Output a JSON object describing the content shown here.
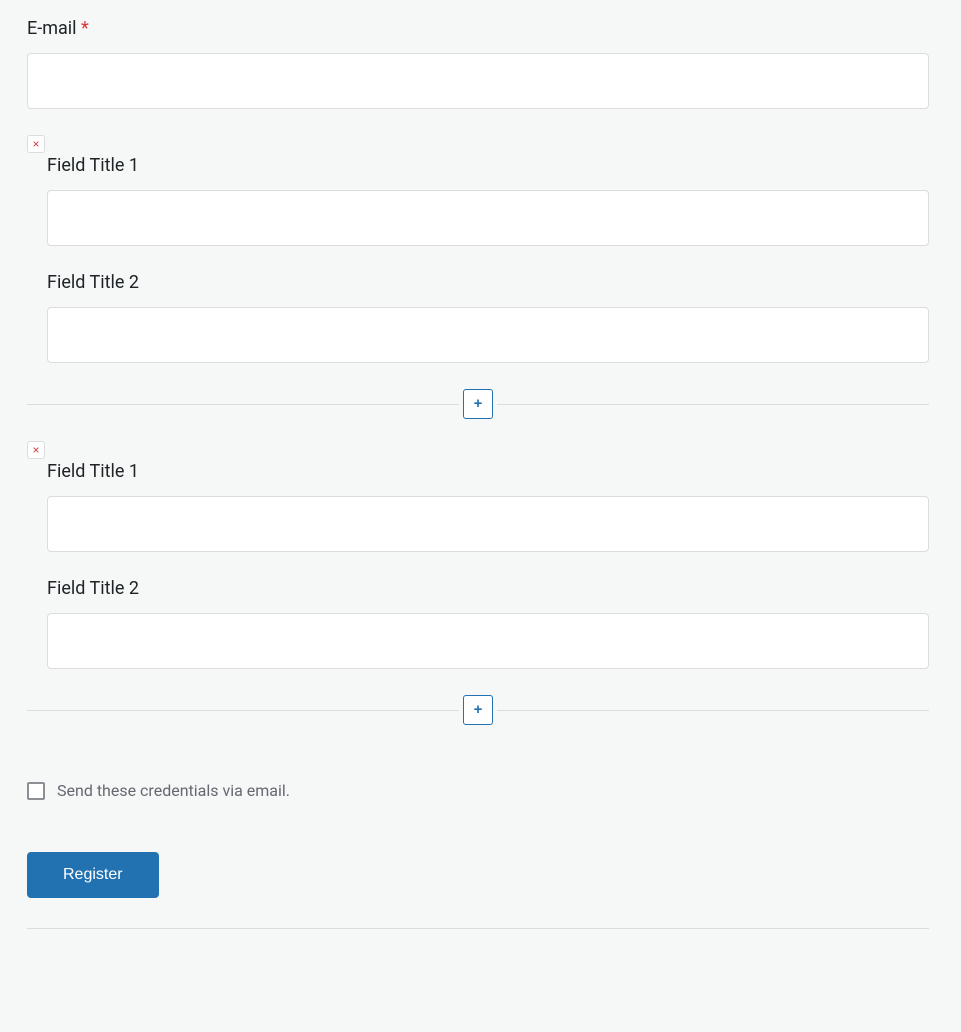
{
  "email_field": {
    "label": "E-mail",
    "required_mark": "*",
    "value": ""
  },
  "repeater_groups": [
    {
      "remove_icon": "×",
      "fields": [
        {
          "label": "Field Title 1",
          "value": ""
        },
        {
          "label": "Field Title 2",
          "value": ""
        }
      ],
      "add_icon": "+"
    },
    {
      "remove_icon": "×",
      "fields": [
        {
          "label": "Field Title 1",
          "value": ""
        },
        {
          "label": "Field Title 2",
          "value": ""
        }
      ],
      "add_icon": "+"
    }
  ],
  "checkbox": {
    "label": "Send these credentials via email.",
    "checked": false
  },
  "submit": {
    "label": "Register"
  }
}
